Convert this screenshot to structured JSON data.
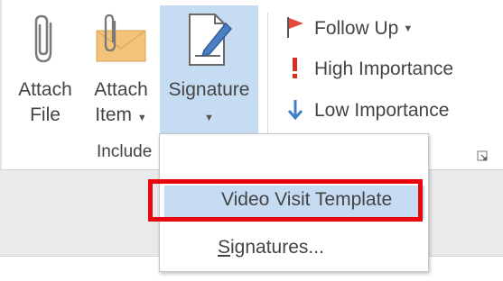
{
  "ribbon": {
    "include_group": {
      "label": "Include",
      "attach_file": {
        "line1": "Attach",
        "line2": "File",
        "icon": "paperclip-icon"
      },
      "attach_item": {
        "line1": "Attach",
        "line2": "Item",
        "icon": "envelope-paperclip-icon"
      },
      "signature": {
        "line1": "Signature",
        "icon": "signature-pen-icon"
      }
    },
    "tags_group": {
      "follow_up": {
        "label": "Follow Up",
        "icon": "red-flag-icon"
      },
      "high_importance": {
        "label": "High Importance",
        "icon": "exclamation-icon"
      },
      "low_importance": {
        "label": "Low Importance",
        "icon": "down-arrow-icon"
      }
    }
  },
  "signature_menu": {
    "items": [
      {
        "label": "Video Visit Template"
      },
      {
        "label_underlined": "S",
        "label_rest": "ignatures..."
      }
    ]
  },
  "colors": {
    "highlight": "#c5dcf2",
    "annotation_box": "#e8070f",
    "flag": "#e04b3a",
    "low_arrow": "#3f7fc8"
  }
}
